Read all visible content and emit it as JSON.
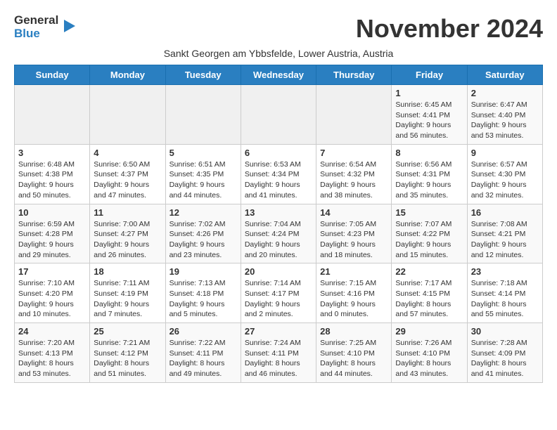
{
  "header": {
    "logo_general": "General",
    "logo_blue": "Blue",
    "month_title": "November 2024",
    "subtitle": "Sankt Georgen am Ybbsfelde, Lower Austria, Austria"
  },
  "days_of_week": [
    "Sunday",
    "Monday",
    "Tuesday",
    "Wednesday",
    "Thursday",
    "Friday",
    "Saturday"
  ],
  "weeks": [
    [
      {
        "day": "",
        "info": ""
      },
      {
        "day": "",
        "info": ""
      },
      {
        "day": "",
        "info": ""
      },
      {
        "day": "",
        "info": ""
      },
      {
        "day": "",
        "info": ""
      },
      {
        "day": "1",
        "info": "Sunrise: 6:45 AM\nSunset: 4:41 PM\nDaylight: 9 hours and 56 minutes."
      },
      {
        "day": "2",
        "info": "Sunrise: 6:47 AM\nSunset: 4:40 PM\nDaylight: 9 hours and 53 minutes."
      }
    ],
    [
      {
        "day": "3",
        "info": "Sunrise: 6:48 AM\nSunset: 4:38 PM\nDaylight: 9 hours and 50 minutes."
      },
      {
        "day": "4",
        "info": "Sunrise: 6:50 AM\nSunset: 4:37 PM\nDaylight: 9 hours and 47 minutes."
      },
      {
        "day": "5",
        "info": "Sunrise: 6:51 AM\nSunset: 4:35 PM\nDaylight: 9 hours and 44 minutes."
      },
      {
        "day": "6",
        "info": "Sunrise: 6:53 AM\nSunset: 4:34 PM\nDaylight: 9 hours and 41 minutes."
      },
      {
        "day": "7",
        "info": "Sunrise: 6:54 AM\nSunset: 4:32 PM\nDaylight: 9 hours and 38 minutes."
      },
      {
        "day": "8",
        "info": "Sunrise: 6:56 AM\nSunset: 4:31 PM\nDaylight: 9 hours and 35 minutes."
      },
      {
        "day": "9",
        "info": "Sunrise: 6:57 AM\nSunset: 4:30 PM\nDaylight: 9 hours and 32 minutes."
      }
    ],
    [
      {
        "day": "10",
        "info": "Sunrise: 6:59 AM\nSunset: 4:28 PM\nDaylight: 9 hours and 29 minutes."
      },
      {
        "day": "11",
        "info": "Sunrise: 7:00 AM\nSunset: 4:27 PM\nDaylight: 9 hours and 26 minutes."
      },
      {
        "day": "12",
        "info": "Sunrise: 7:02 AM\nSunset: 4:26 PM\nDaylight: 9 hours and 23 minutes."
      },
      {
        "day": "13",
        "info": "Sunrise: 7:04 AM\nSunset: 4:24 PM\nDaylight: 9 hours and 20 minutes."
      },
      {
        "day": "14",
        "info": "Sunrise: 7:05 AM\nSunset: 4:23 PM\nDaylight: 9 hours and 18 minutes."
      },
      {
        "day": "15",
        "info": "Sunrise: 7:07 AM\nSunset: 4:22 PM\nDaylight: 9 hours and 15 minutes."
      },
      {
        "day": "16",
        "info": "Sunrise: 7:08 AM\nSunset: 4:21 PM\nDaylight: 9 hours and 12 minutes."
      }
    ],
    [
      {
        "day": "17",
        "info": "Sunrise: 7:10 AM\nSunset: 4:20 PM\nDaylight: 9 hours and 10 minutes."
      },
      {
        "day": "18",
        "info": "Sunrise: 7:11 AM\nSunset: 4:19 PM\nDaylight: 9 hours and 7 minutes."
      },
      {
        "day": "19",
        "info": "Sunrise: 7:13 AM\nSunset: 4:18 PM\nDaylight: 9 hours and 5 minutes."
      },
      {
        "day": "20",
        "info": "Sunrise: 7:14 AM\nSunset: 4:17 PM\nDaylight: 9 hours and 2 minutes."
      },
      {
        "day": "21",
        "info": "Sunrise: 7:15 AM\nSunset: 4:16 PM\nDaylight: 9 hours and 0 minutes."
      },
      {
        "day": "22",
        "info": "Sunrise: 7:17 AM\nSunset: 4:15 PM\nDaylight: 8 hours and 57 minutes."
      },
      {
        "day": "23",
        "info": "Sunrise: 7:18 AM\nSunset: 4:14 PM\nDaylight: 8 hours and 55 minutes."
      }
    ],
    [
      {
        "day": "24",
        "info": "Sunrise: 7:20 AM\nSunset: 4:13 PM\nDaylight: 8 hours and 53 minutes."
      },
      {
        "day": "25",
        "info": "Sunrise: 7:21 AM\nSunset: 4:12 PM\nDaylight: 8 hours and 51 minutes."
      },
      {
        "day": "26",
        "info": "Sunrise: 7:22 AM\nSunset: 4:11 PM\nDaylight: 8 hours and 49 minutes."
      },
      {
        "day": "27",
        "info": "Sunrise: 7:24 AM\nSunset: 4:11 PM\nDaylight: 8 hours and 46 minutes."
      },
      {
        "day": "28",
        "info": "Sunrise: 7:25 AM\nSunset: 4:10 PM\nDaylight: 8 hours and 44 minutes."
      },
      {
        "day": "29",
        "info": "Sunrise: 7:26 AM\nSunset: 4:10 PM\nDaylight: 8 hours and 43 minutes."
      },
      {
        "day": "30",
        "info": "Sunrise: 7:28 AM\nSunset: 4:09 PM\nDaylight: 8 hours and 41 minutes."
      }
    ]
  ]
}
